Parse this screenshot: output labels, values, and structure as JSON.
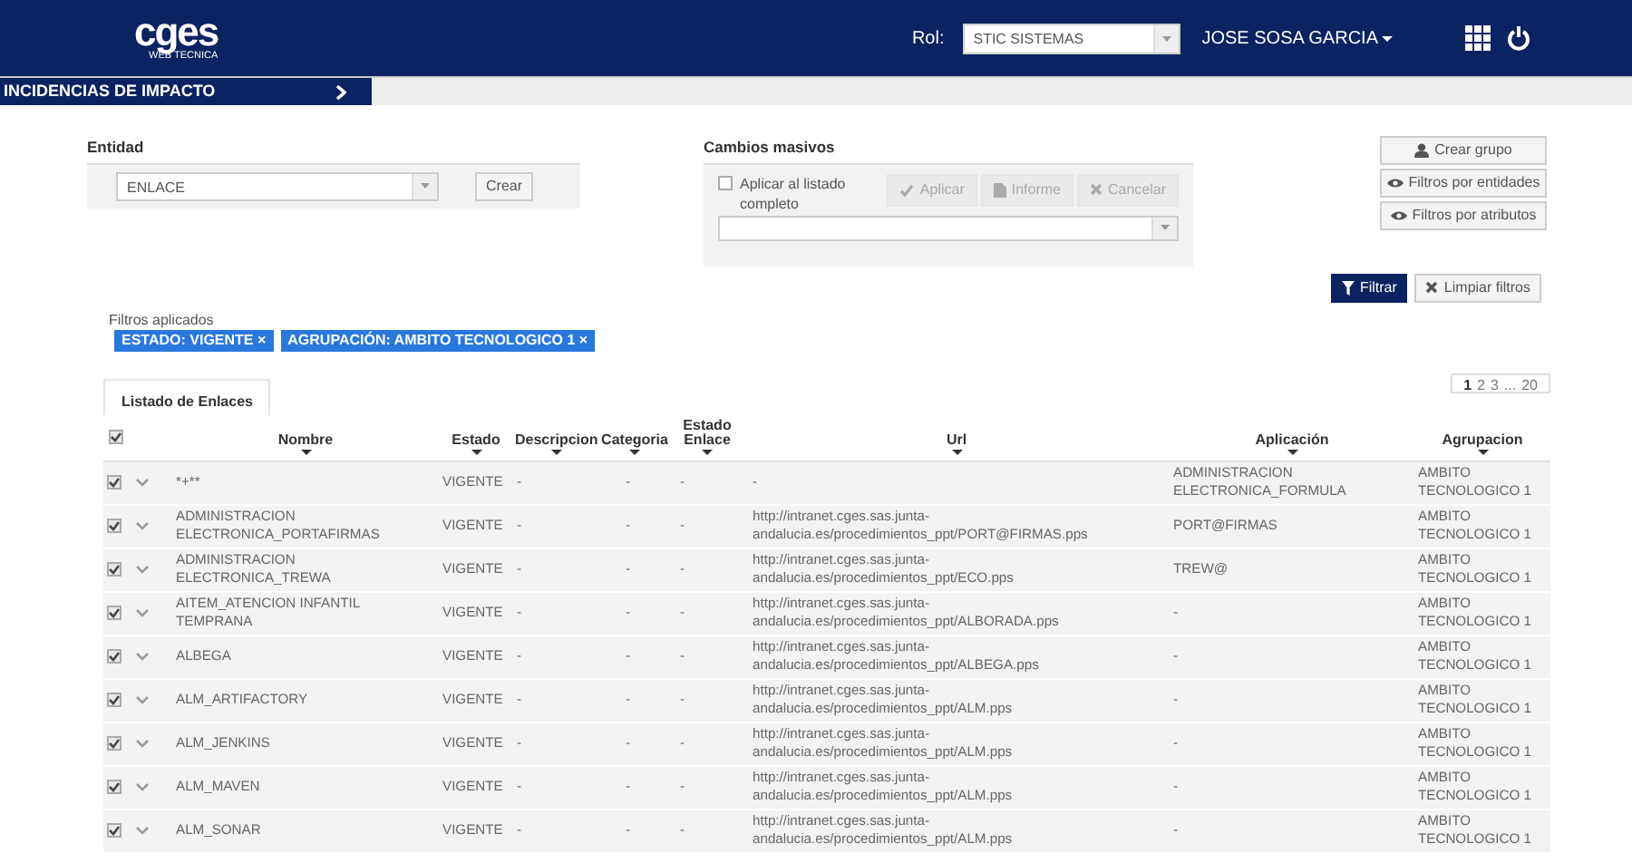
{
  "header": {
    "logo": "cges",
    "logo_subtitle": "WEB TECNICA",
    "role_label": "Rol:",
    "role_value": "STIC SISTEMAS",
    "user": "JOSE SOSA GARCIA"
  },
  "breadcrumb": {
    "title": "INCIDENCIAS DE IMPACTO"
  },
  "entidad": {
    "label": "Entidad",
    "value": "ENLACE",
    "button": "Crear"
  },
  "cambios": {
    "label": "Cambios masivos",
    "apply_all": {
      "label": "Aplicar al listado completo",
      "checked": false
    },
    "actions": [
      {
        "label": "Aplicar",
        "disabled": true
      },
      {
        "label": "Informe",
        "disabled": true
      },
      {
        "label": "Cancelar",
        "disabled": true
      }
    ]
  },
  "side_buttons": [
    {
      "label": "Crear grupo"
    },
    {
      "label": "Filtros por entidades"
    },
    {
      "label": "Filtros por atributos"
    }
  ],
  "filter_buttons": [
    {
      "label": "Filtrar",
      "primary": true
    },
    {
      "label": "Limpiar filtros",
      "primary": false
    }
  ],
  "applied_filters": {
    "label": "Filtros aplicados",
    "tags": [
      {
        "label": "ESTADO: VIGENTE",
        "remove": "×"
      },
      {
        "label": "AGRUPACIÓN: AMBITO TECNOLOGICO 1",
        "remove": "×"
      }
    ]
  },
  "table": {
    "tab": "Listado de Enlaces",
    "pagination": [
      {
        "label": "1",
        "selected": true
      },
      {
        "label": "2",
        "selected": false
      },
      {
        "label": "3",
        "selected": false
      },
      {
        "label": "...",
        "selected": false
      },
      {
        "label": "20",
        "selected": false
      }
    ],
    "select_all_checked": true,
    "columns": [
      "Nombre",
      "Estado",
      "Descripcion",
      "Categoria",
      "Estado Enlace",
      "Url",
      "Aplicación",
      "Agrupacion"
    ],
    "rows": [
      {
        "checked": true,
        "cells": [
          "*+**",
          "VIGENTE",
          "-",
          "-",
          "-",
          "-",
          "ADMINISTRACION ELECTRONICA_FORMULA",
          "AMBITO TECNOLOGICO 1"
        ]
      },
      {
        "checked": true,
        "cells": [
          "ADMINISTRACION ELECTRONICA_PORTAFIRMAS",
          "VIGENTE",
          "-",
          "-",
          "-",
          "http://intranet.cges.sas.junta-andalucia.es/procedimientos_ppt/PORT@FIRMAS.pps",
          "PORT@FIRMAS",
          "AMBITO TECNOLOGICO 1"
        ]
      },
      {
        "checked": true,
        "cells": [
          "ADMINISTRACION ELECTRONICA_TREWA",
          "VIGENTE",
          "-",
          "-",
          "-",
          "http://intranet.cges.sas.junta-andalucia.es/procedimientos_ppt/ECO.pps",
          "TREW@",
          "AMBITO TECNOLOGICO 1"
        ]
      },
      {
        "checked": true,
        "cells": [
          "AITEM_ATENCION INFANTIL TEMPRANA",
          "VIGENTE",
          "-",
          "-",
          "-",
          "http://intranet.cges.sas.junta-andalucia.es/procedimientos_ppt/ALBORADA.pps",
          "-",
          "AMBITO TECNOLOGICO 1"
        ]
      },
      {
        "checked": true,
        "cells": [
          "ALBEGA",
          "VIGENTE",
          "-",
          "-",
          "-",
          "http://intranet.cges.sas.junta-andalucia.es/procedimientos_ppt/ALBEGA.pps",
          "-",
          "AMBITO TECNOLOGICO 1"
        ]
      },
      {
        "checked": true,
        "cells": [
          "ALM_ARTIFACTORY",
          "VIGENTE",
          "-",
          "-",
          "-",
          "http://intranet.cges.sas.junta-andalucia.es/procedimientos_ppt/ALM.pps",
          "-",
          "AMBITO TECNOLOGICO 1"
        ]
      },
      {
        "checked": true,
        "cells": [
          "ALM_JENKINS",
          "VIGENTE",
          "-",
          "-",
          "-",
          "http://intranet.cges.sas.junta-andalucia.es/procedimientos_ppt/ALM.pps",
          "-",
          "AMBITO TECNOLOGICO 1"
        ]
      },
      {
        "checked": true,
        "cells": [
          "ALM_MAVEN",
          "VIGENTE",
          "-",
          "-",
          "-",
          "http://intranet.cges.sas.junta-andalucia.es/procedimientos_ppt/ALM.pps",
          "-",
          "AMBITO TECNOLOGICO 1"
        ]
      },
      {
        "checked": true,
        "cells": [
          "ALM_SONAR",
          "VIGENTE",
          "-",
          "-",
          "-",
          "http://intranet.cges.sas.junta-andalucia.es/procedimientos_ppt/ALM.pps",
          "-",
          "AMBITO TECNOLOGICO 1"
        ]
      }
    ]
  }
}
